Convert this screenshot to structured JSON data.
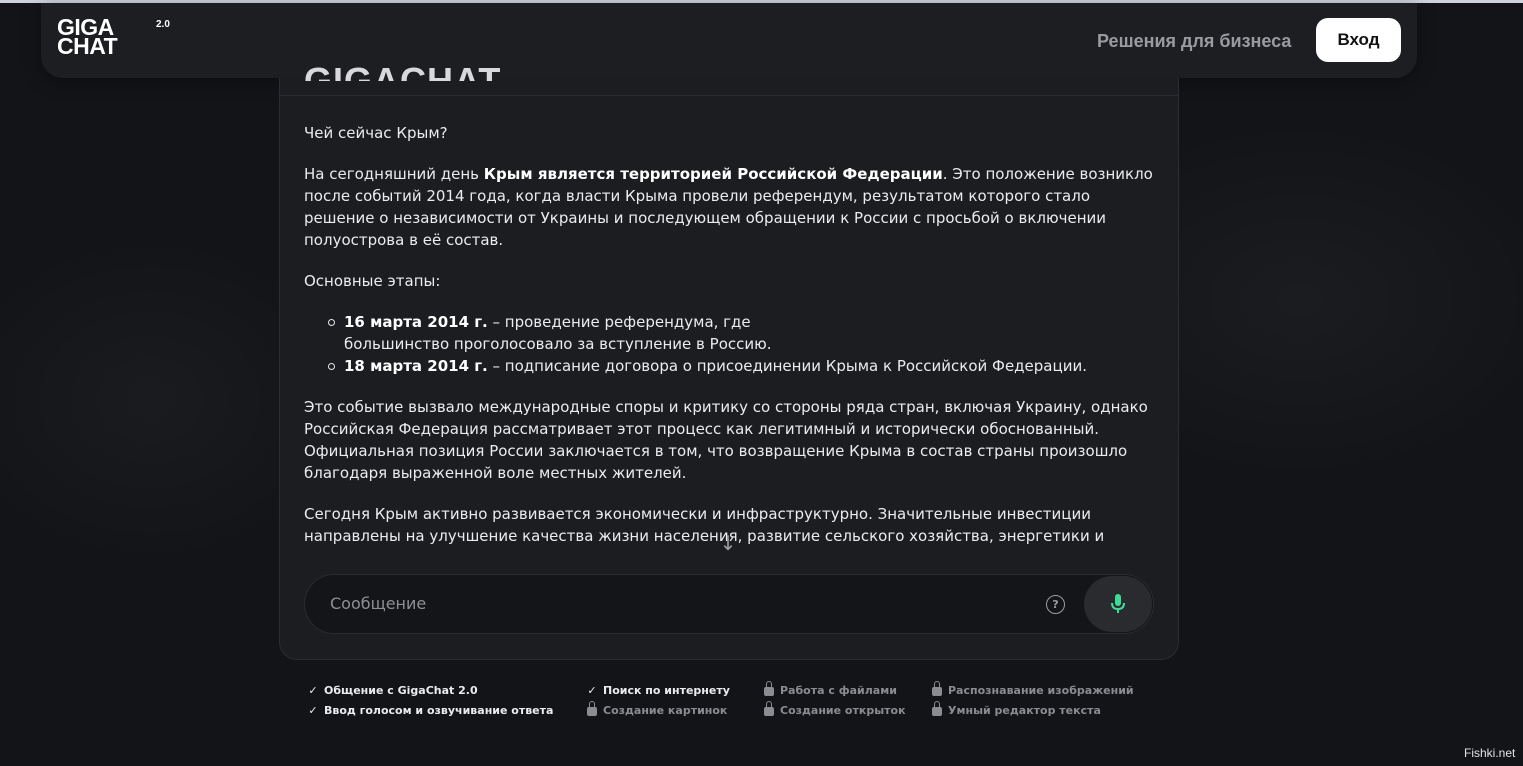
{
  "header": {
    "logo_line1": "GIGA",
    "logo_line2": "CHAT",
    "logo_version": "2.0",
    "business_link": "Решения для бизнеса",
    "login_button": "Вход"
  },
  "panel": {
    "title": "GIGACHAT"
  },
  "chat": {
    "question": "Чей сейчас Крым?",
    "answer_p1_start": "На сегодняшний день ",
    "answer_p1_bold": "Крым является территорией Российской Федерации",
    "answer_p1_end": ". Это положение возникло после событий 2014 года, когда власти Крыма провели референдум, результатом которого стало решение о независимости от Украины и последующем обращении к России с просьбой о включении полуострова в её состав.",
    "stages_heading": "Основные этапы:",
    "stages": [
      {
        "date": "16 марта 2014 г.",
        "text": " – проведение референдума, где"
      },
      {
        "date": "18 марта 2014 г.",
        "text": " – подписание договора о присоединении Крыма к Российской Федерации."
      }
    ],
    "stage1_continuation": "большинство проголосовало за вступление в Россию.",
    "answer_p2": "Это событие вызвало международные споры и критику со стороны ряда стран, включая Украину, однако Российская Федерация рассматривает этот процесс как легитимный и исторически обоснованный. Официальная позиция России заключается в том, что возвращение Крыма в состав страны произошло благодаря выраженной воле местных жителей.",
    "answer_p3": "Сегодня Крым активно развивается экономически и инфраструктурно. Значительные инвестиции направлены на улучшение качества жизни населения, развитие сельского хозяйства, энергетики и социальной сферы. Среди значимых проектов последних лет:"
  },
  "input": {
    "placeholder": "Сообщение"
  },
  "features": {
    "col1": [
      {
        "label": "Общение с GigaChat 2.0",
        "icon": "check-icon",
        "enabled": true
      },
      {
        "label": "Ввод голосом и озвучивание ответа",
        "icon": "check-icon",
        "enabled": true
      }
    ],
    "col2": [
      {
        "label": "Поиск по интернету",
        "icon": "check-icon",
        "enabled": true
      },
      {
        "label": "Создание картинок",
        "icon": "lock-icon",
        "enabled": false
      }
    ],
    "col3": [
      {
        "label": "Работа с файлами",
        "icon": "lock-icon",
        "enabled": false
      },
      {
        "label": "Создание открыток",
        "icon": "lock-icon",
        "enabled": false
      }
    ],
    "col4": [
      {
        "label": "Распознавание изображений",
        "icon": "lock-icon",
        "enabled": false
      },
      {
        "label": "Умный редактор текста",
        "icon": "lock-icon",
        "enabled": false
      }
    ]
  },
  "watermark": "Fishki.net",
  "colors": {
    "background": "#131418",
    "panel": "#1c1d21",
    "mic_accent": "#3ddc97"
  }
}
